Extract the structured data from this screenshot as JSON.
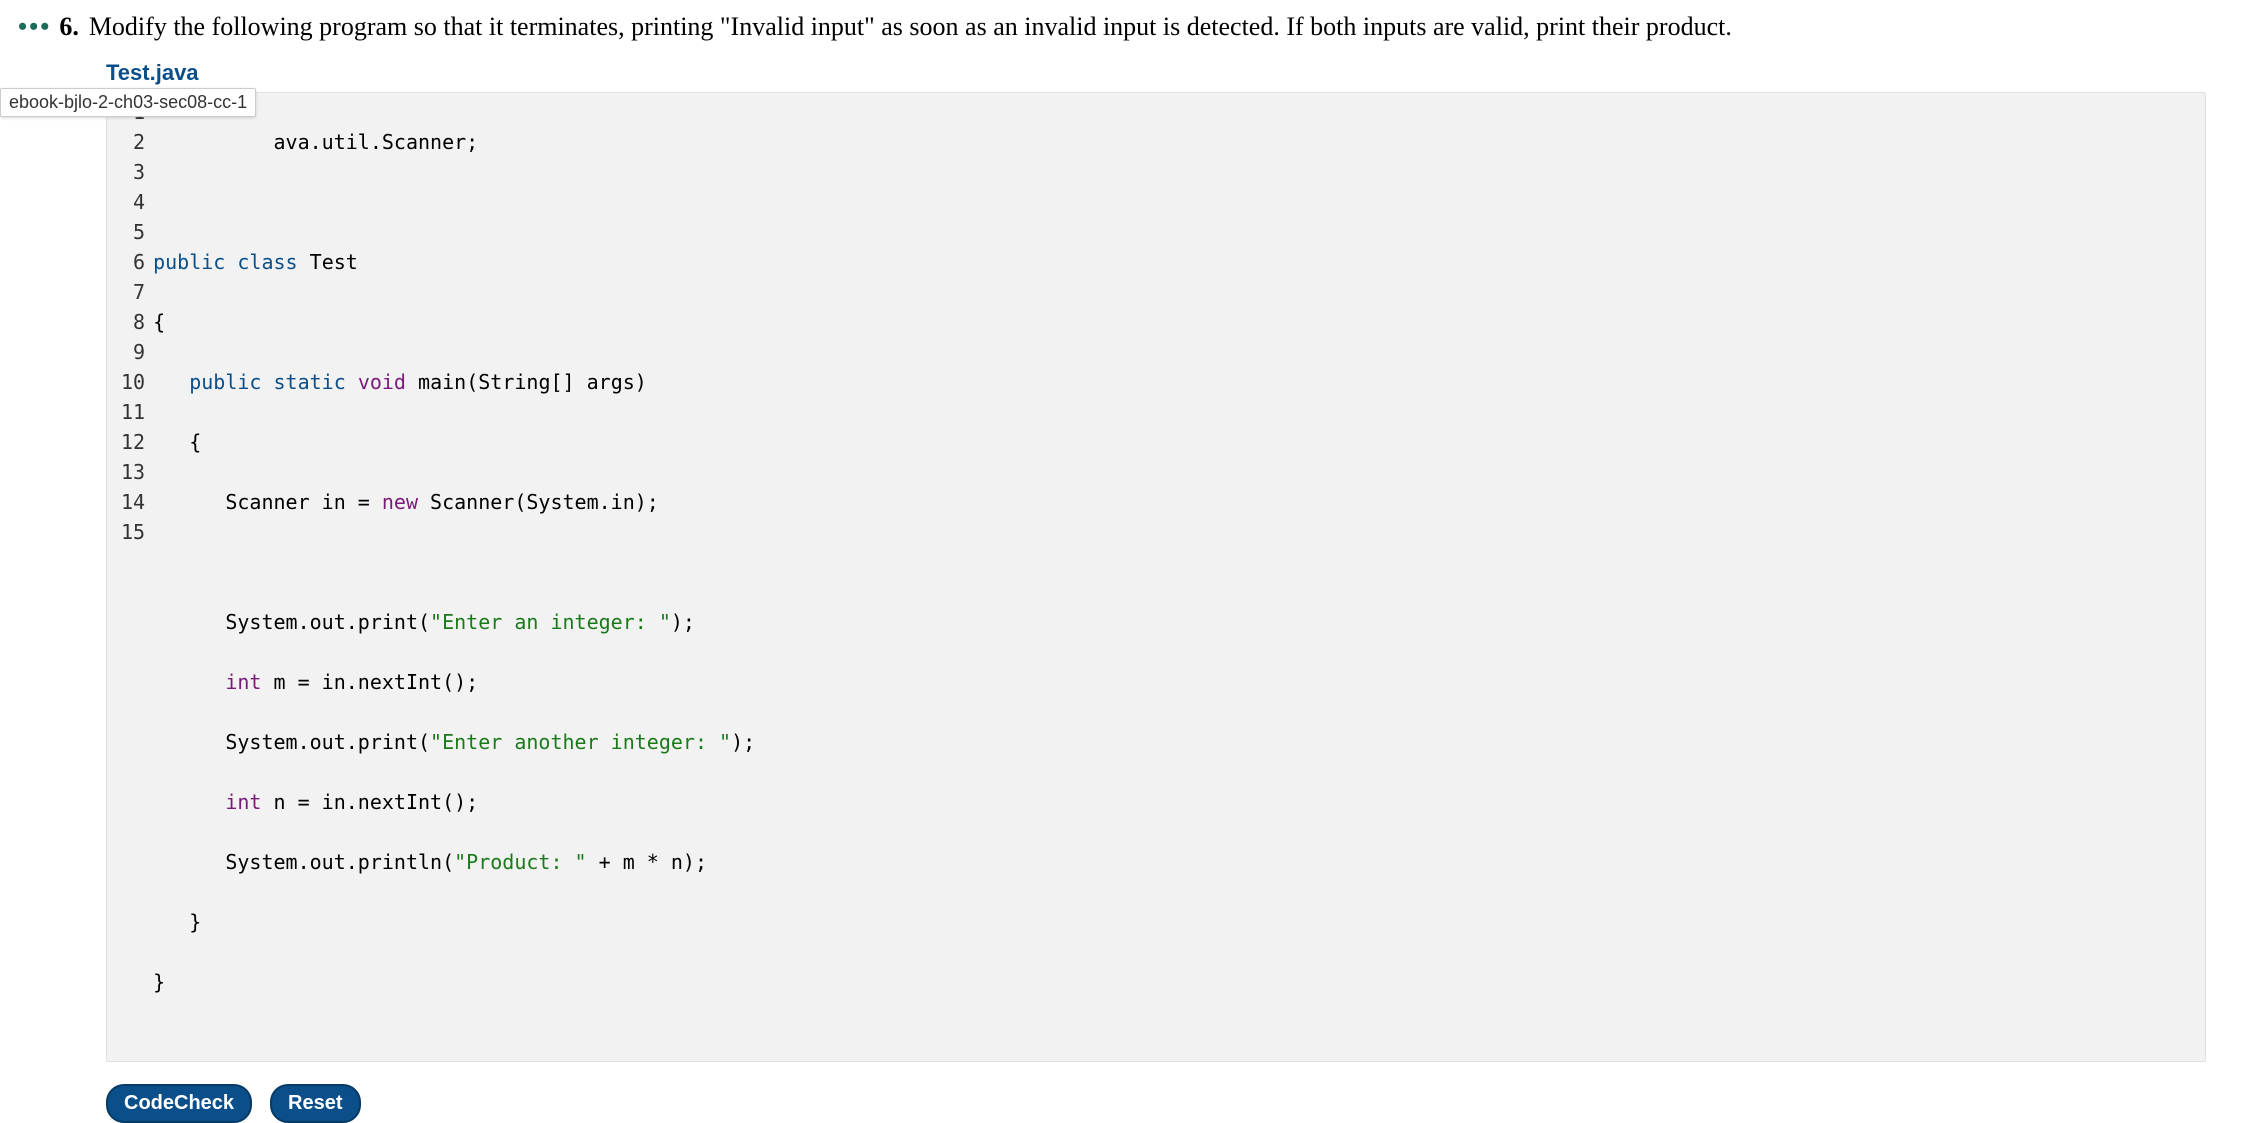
{
  "question": {
    "dots": "•••",
    "number": "6.",
    "text": "Modify the following program so that it terminates, printing \"Invalid input\" as soon as an invalid input is detected. If both inputs are valid, print their product."
  },
  "filename": "Test.java",
  "tooltip": "ebook-bjlo-2-ch03-sec08-cc-1",
  "code": {
    "line_numbers": [
      "1",
      "2",
      "3",
      "4",
      "5",
      "6",
      "7",
      "8",
      "9",
      "10",
      "11",
      "12",
      "13",
      "14",
      "15"
    ],
    "lines": {
      "l1_frag": "ava.util.Scanner;",
      "l2": "",
      "l3_public": "public",
      "l3_class": "class",
      "l3_name": "Test",
      "l4": "{",
      "l5_public": "public",
      "l5_static": "static",
      "l5_void": "void",
      "l5_main": "main(String[] args)",
      "l6": "   {",
      "l7_a": "      Scanner in = ",
      "l7_new": "new",
      "l7_b": " Scanner(System.in);",
      "l8": "",
      "l9_a": "      System.out.print(",
      "l9_str": "\"Enter an integer: \"",
      "l9_b": ");",
      "l10_a": "      ",
      "l10_int": "int",
      "l10_b": " m = in.nextInt();",
      "l11_a": "      System.out.print(",
      "l11_str": "\"Enter another integer: \"",
      "l11_b": ");",
      "l12_a": "      ",
      "l12_int": "int",
      "l12_b": " n = in.nextInt();",
      "l13_a": "      System.out.println(",
      "l13_str": "\"Product: \"",
      "l13_b": " + m * n);",
      "l14": "   }",
      "l15": "}"
    }
  },
  "buttons": {
    "codecheck": "CodeCheck",
    "reset": "Reset"
  }
}
